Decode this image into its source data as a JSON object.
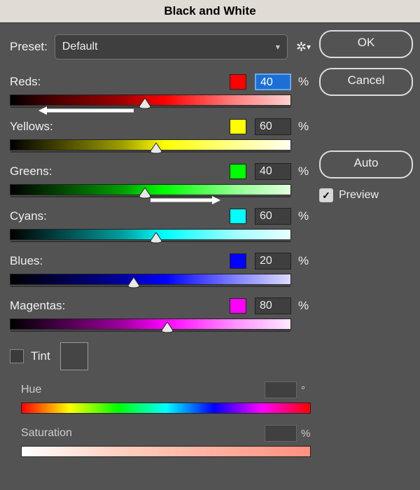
{
  "title": "Black and White",
  "preset": {
    "label": "Preset:",
    "selected": "Default"
  },
  "buttons": {
    "ok": "OK",
    "cancel": "Cancel",
    "auto": "Auto"
  },
  "preview": {
    "label": "Preview",
    "checked": true
  },
  "chart_data": {
    "type": "table",
    "title": "Black and White channel mixer values",
    "categories": [
      "Reds",
      "Yellows",
      "Greens",
      "Cyans",
      "Blues",
      "Magentas"
    ],
    "values": [
      40,
      60,
      40,
      60,
      20,
      80
    ],
    "unit": "%",
    "range": [
      -200,
      300
    ]
  },
  "sliders": [
    {
      "label": "Reds:",
      "value": 40,
      "color": "#ff0000",
      "selected": true,
      "gradient": "linear-gradient(to right,#000 0%,#4a0000 15%,#9e0000 40%,#ff0000 55%,#ff8080 80%,#ffd0d0 100%)",
      "thumbPct": 48,
      "arrow": {
        "from": 44,
        "to": 10
      }
    },
    {
      "label": "Yellows:",
      "value": 60,
      "color": "#ffff00",
      "gradient": "linear-gradient(to right,#000 0%,#3a3a00 15%,#9e9e00 40%,#ffff00 55%,#ffff90 80%,#fffff0 100%)",
      "thumbPct": 52
    },
    {
      "label": "Greens:",
      "value": 40,
      "color": "#00ff00",
      "gradient": "linear-gradient(to right,#000 0%,#003a00 15%,#009e00 40%,#00ff00 55%,#90ff90 80%,#e0ffe0 100%)",
      "thumbPct": 48,
      "arrow": {
        "from": 50,
        "to": 75
      }
    },
    {
      "label": "Cyans:",
      "value": 60,
      "color": "#00ffff",
      "gradient": "linear-gradient(to right,#000 0%,#003a3a 15%,#009e9e 40%,#00ffff 55%,#a0ffff 80%,#e8ffff 100%)",
      "thumbPct": 52
    },
    {
      "label": "Blues:",
      "value": 20,
      "color": "#0000ff",
      "gradient": "linear-gradient(to right,#000 0%,#00003a 15%,#00009e 40%,#0000ff 55%,#8080ff 80%,#dcdcff 100%)",
      "thumbPct": 44
    },
    {
      "label": "Magentas:",
      "value": 80,
      "color": "#ff00ff",
      "gradient": "linear-gradient(to right,#000 0%,#3a003a 15%,#9e009e 40%,#ff00ff 55%,#ff90ff 80%,#ffe8ff 100%)",
      "thumbPct": 56
    }
  ],
  "tint": {
    "label": "Tint",
    "checked": false
  },
  "hue": {
    "label": "Hue",
    "unit": "°",
    "gradient": "linear-gradient(to right,#ff0000,#ffff00,#00ff00,#00ffff,#0000ff,#ff00ff,#ff0000)"
  },
  "saturation": {
    "label": "Saturation",
    "unit": "%",
    "gradient": "linear-gradient(to right,#ffffff,#ffd0c0,#ffb0a0,#ff9080)"
  }
}
